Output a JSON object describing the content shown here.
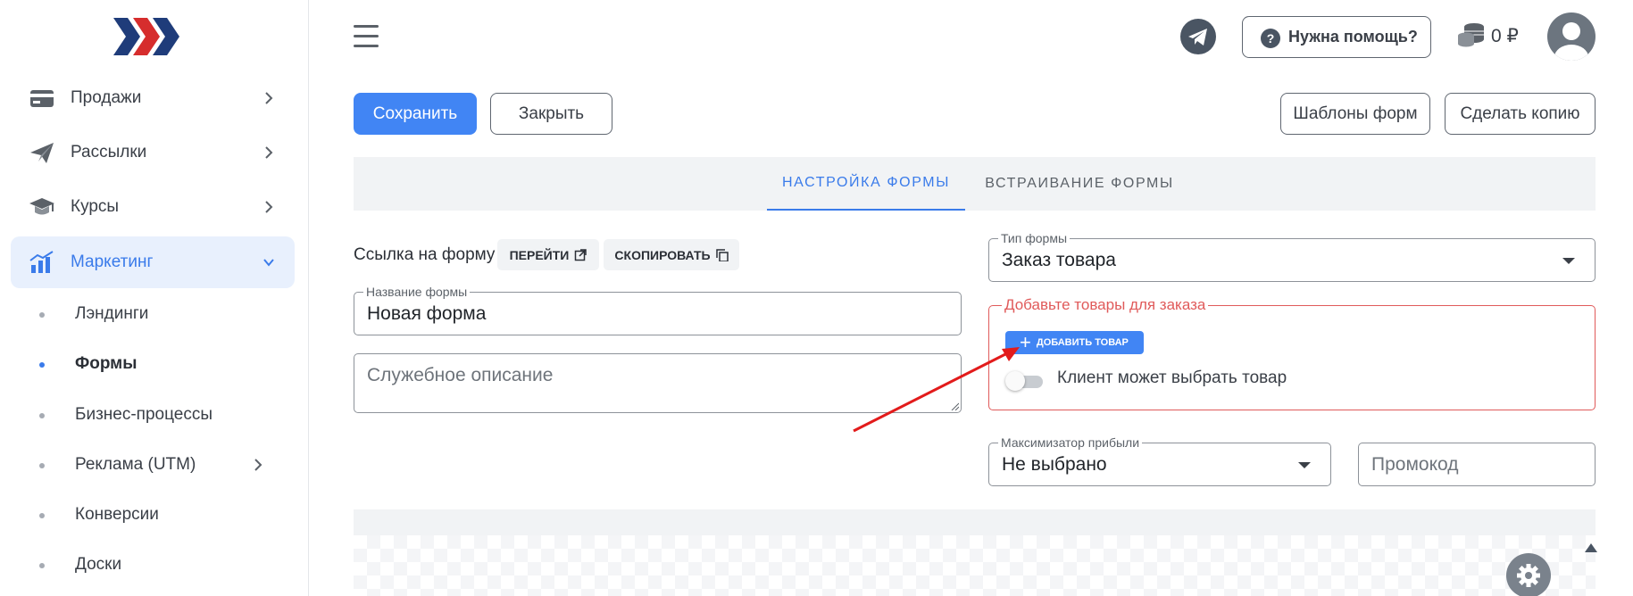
{
  "sidebar": {
    "logo_icon": "chevrons-logo-icon",
    "items": [
      {
        "label": "Продажи",
        "icon": "credit-card-icon"
      },
      {
        "label": "Рассылки",
        "icon": "paper-plane-icon"
      },
      {
        "label": "Курсы",
        "icon": "graduation-cap-icon"
      },
      {
        "label": "Маркетинг",
        "icon": "chart-icon",
        "active": true
      }
    ],
    "subitems": [
      {
        "label": "Лэндинги"
      },
      {
        "label": "Формы",
        "active": true
      },
      {
        "label": "Бизнес-процессы"
      },
      {
        "label": "Реклама (UTM)"
      },
      {
        "label": "Конверсии"
      },
      {
        "label": "Доски"
      }
    ]
  },
  "header": {
    "help_label": "Нужна помощь?",
    "help_icon": "?",
    "balance": "0 ₽"
  },
  "toolbar": {
    "save_label": "Сохранить",
    "close_label": "Закрыть",
    "templates_label": "Шаблоны форм",
    "copy_label": "Сделать копию"
  },
  "tabs": [
    {
      "label": "НАСТРОЙКА ФОРМЫ",
      "active": true
    },
    {
      "label": "ВСТРАИВАНИЕ ФОРМЫ"
    }
  ],
  "form": {
    "link_label": "Ссылка на форму",
    "goto_label": "ПЕРЕЙТИ",
    "copy_link_label": "СКОПИРОВАТЬ",
    "name_legend": "Название формы",
    "name_value": "Новая форма",
    "description_placeholder": "Служебное описание",
    "type_legend": "Тип формы",
    "type_value": "Заказ товара",
    "products_legend": "Добавьте товары для заказа",
    "add_product_label": "ДОБАВИТЬ ТОВАР",
    "client_choice_label": "Клиент может выбрать товар",
    "client_choice_on": false,
    "maximizer_legend": "Максимизатор прибыли",
    "maximizer_value": "Не выбрано",
    "promo_placeholder": "Промокод"
  },
  "colors": {
    "primary": "#4185f4",
    "active_text": "#3a7bea",
    "error": "#e05a5a",
    "annotation": "#e21b1b"
  }
}
